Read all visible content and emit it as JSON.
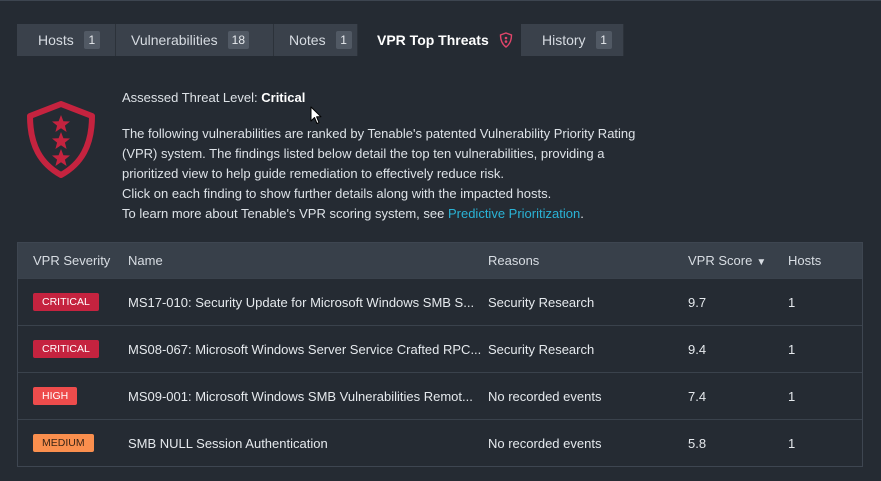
{
  "tabs": [
    {
      "label": "Hosts",
      "count": "1"
    },
    {
      "label": "Vulnerabilities",
      "count": "18"
    },
    {
      "label": "Notes",
      "count": "1"
    },
    {
      "label": "VPR Top Threats",
      "icon": "shield-star-icon"
    },
    {
      "label": "History",
      "count": "1"
    }
  ],
  "intro": {
    "threat_label": "Assessed Threat Level:",
    "threat_value": "Critical",
    "line1": "The following vulnerabilities are ranked by Tenable's patented Vulnerability Priority Rating",
    "line2": "(VPR) system. The findings listed below detail the top ten vulnerabilities, providing a",
    "line3": "prioritized view to help guide remediation to effectively reduce risk.",
    "line4": "Click on each finding to show further details along with the impacted hosts.",
    "line5_prefix": "To learn more about Tenable's VPR scoring system, see ",
    "link_text": "Predictive Prioritization",
    "line5_suffix": "."
  },
  "table": {
    "headers": {
      "severity": "VPR Severity",
      "name": "Name",
      "reasons": "Reasons",
      "score": "VPR Score",
      "sort_indicator": "▼",
      "hosts": "Hosts"
    },
    "rows": [
      {
        "severity": "CRITICAL",
        "name": "MS17-010: Security Update for Microsoft Windows SMB S...",
        "reasons": "Security Research",
        "score": "9.7",
        "hosts": "1"
      },
      {
        "severity": "CRITICAL",
        "name": "MS08-067: Microsoft Windows Server Service Crafted RPC...",
        "reasons": "Security Research",
        "score": "9.4",
        "hosts": "1"
      },
      {
        "severity": "HIGH",
        "name": "MS09-001: Microsoft Windows SMB Vulnerabilities Remot...",
        "reasons": "No recorded events",
        "score": "7.4",
        "hosts": "1"
      },
      {
        "severity": "MEDIUM",
        "name": "SMB NULL Session Authentication",
        "reasons": "No recorded events",
        "score": "5.8",
        "hosts": "1"
      }
    ]
  },
  "colors": {
    "background": "#252b33",
    "accent_critical": "#c5233f",
    "high": "#ee4c4c",
    "medium": "#fa8f4e",
    "link": "#2ab3d6"
  },
  "icons": {
    "threat_level": "shield-three-stars-icon",
    "cursor": "mouse-pointer-icon"
  }
}
